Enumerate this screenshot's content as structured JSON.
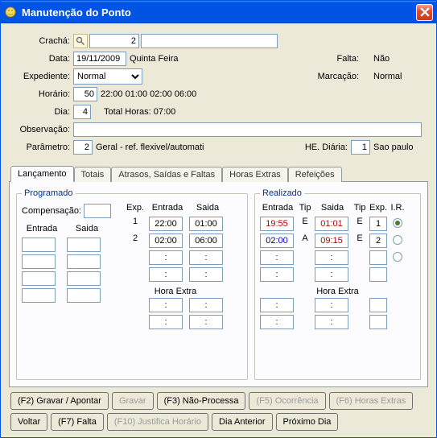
{
  "window": {
    "title": "Manutenção do Ponto"
  },
  "form": {
    "cracha_label": "Crachá:",
    "cracha_value": "2",
    "cracha_display": "",
    "data_label": "Data:",
    "data_value": "19/11/2009",
    "data_weekday": "Quinta Feira",
    "falta_label": "Falta:",
    "falta_value": "Não",
    "marcacao_label": "Marcação:",
    "marcacao_value": "Normal",
    "expediente_label": "Expediente:",
    "expediente_value": "Normal",
    "horario_label": "Horário:",
    "horario_value": "50",
    "horario_times": "22:00 01:00 02:00 06:00",
    "dia_label": "Dia:",
    "dia_value": "4",
    "total_horas": "Total Horas: 07:00",
    "observacao_label": "Observação:",
    "observacao_value": "",
    "parametro_label": "Parâmetro:",
    "parametro_value": "2",
    "parametro_desc": "Geral - ref. flexivel/automati",
    "he_diaria_label": "HE. Diária:",
    "he_diaria_value": "1",
    "he_diaria_desc": "Sao paulo"
  },
  "tabs": {
    "lancamento": "Lançamento",
    "totais": "Totais",
    "atrasos": "Atrasos, Saídas e Faltas",
    "horas_extras": "Horas Extras",
    "refeicoes": "Refeições"
  },
  "programado": {
    "title": "Programado",
    "compensacao_label": "Compensação:",
    "compensacao_value": "",
    "hdr_exp": "Exp.",
    "hdr_entrada": "Entrada",
    "hdr_saida": "Saida",
    "rows": [
      {
        "exp": "1",
        "entrada": "22:00",
        "saida": "01:00"
      },
      {
        "exp": "2",
        "entrada": "02:00",
        "saida": "06:00"
      },
      {
        "exp": "",
        "entrada": ":",
        "saida": ":"
      },
      {
        "exp": "",
        "entrada": ":",
        "saida": ":"
      }
    ],
    "hora_extra_label": "Hora Extra",
    "hora_extra": [
      {
        "entrada": ":",
        "saida": ":"
      },
      {
        "entrada": ":",
        "saida": ":"
      }
    ],
    "entrada_saida_hdr_entrada": "Entrada",
    "entrada_saida_hdr_saida": "Saida",
    "left_pairs": [
      {
        "a": "",
        "b": ""
      },
      {
        "a": "",
        "b": ""
      },
      {
        "a": "",
        "b": ""
      },
      {
        "a": "",
        "b": ""
      }
    ]
  },
  "realizado": {
    "title": "Realizado",
    "hdr_entrada": "Entrada",
    "hdr_tip1": "Tip",
    "hdr_saida": "Saida",
    "hdr_tip2": "Tip",
    "hdr_exp": "Exp.",
    "hdr_ir": "I.R.",
    "rows": [
      {
        "entrada": "19:55",
        "entrada_style": "red",
        "tip1": "E",
        "saida": "01:01",
        "saida_style": "red",
        "tip2": "E",
        "exp": "1"
      },
      {
        "entrada": "02:00",
        "entrada_style": "blue",
        "tip1": "A",
        "saida": "09:15",
        "saida_style": "red",
        "tip2": "E",
        "exp": "2"
      },
      {
        "entrada": ":",
        "entrada_style": "",
        "tip1": "",
        "saida": ":",
        "saida_style": "",
        "tip2": "",
        "exp": ""
      },
      {
        "entrada": ":",
        "entrada_style": "",
        "tip1": "",
        "saida": ":",
        "saida_style": "",
        "tip2": "",
        "exp": ""
      }
    ],
    "ir_selected": 0,
    "hora_extra_label": "Hora Extra",
    "hora_extra": [
      {
        "entrada": ":",
        "tip1": "",
        "saida": ":",
        "tip2": "",
        "exp": ""
      },
      {
        "entrada": ":",
        "tip1": "",
        "saida": ":",
        "tip2": "",
        "exp": ""
      }
    ]
  },
  "buttons": {
    "gravar_apontar": "(F2) Gravar / Apontar",
    "gravar": "Gravar",
    "nao_processa": "(F3) Não-Processa",
    "ocorrencia": "(F5) Ocorrência",
    "horas_extras": "(F6) Horas Extras",
    "voltar": "Voltar",
    "falta": "(F7) Falta",
    "justifica": "(F10) Justifica Horário",
    "dia_anterior": "Dia Anterior",
    "proximo_dia": "Próximo Dia"
  }
}
